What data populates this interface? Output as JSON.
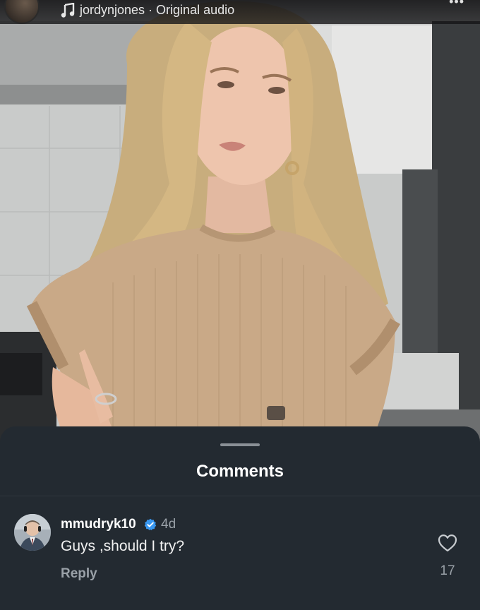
{
  "audio_bar": {
    "icon": "music-note-icon",
    "text": "jordynjones · Original audio",
    "more_icon": "more-dots-icon"
  },
  "video": {
    "description_icon": "video-frame"
  },
  "sheet": {
    "title": "Comments",
    "comments": [
      {
        "username": "mmudryk10",
        "verified": true,
        "time": "4d",
        "text": "Guys ,should I try?",
        "reply_label": "Reply",
        "like_icon": "heart-outline-icon",
        "like_count": "17"
      }
    ]
  },
  "colors": {
    "sheet_bg": "#232a31",
    "verified_blue": "#3897f0",
    "muted_text": "#9aa1a8"
  }
}
